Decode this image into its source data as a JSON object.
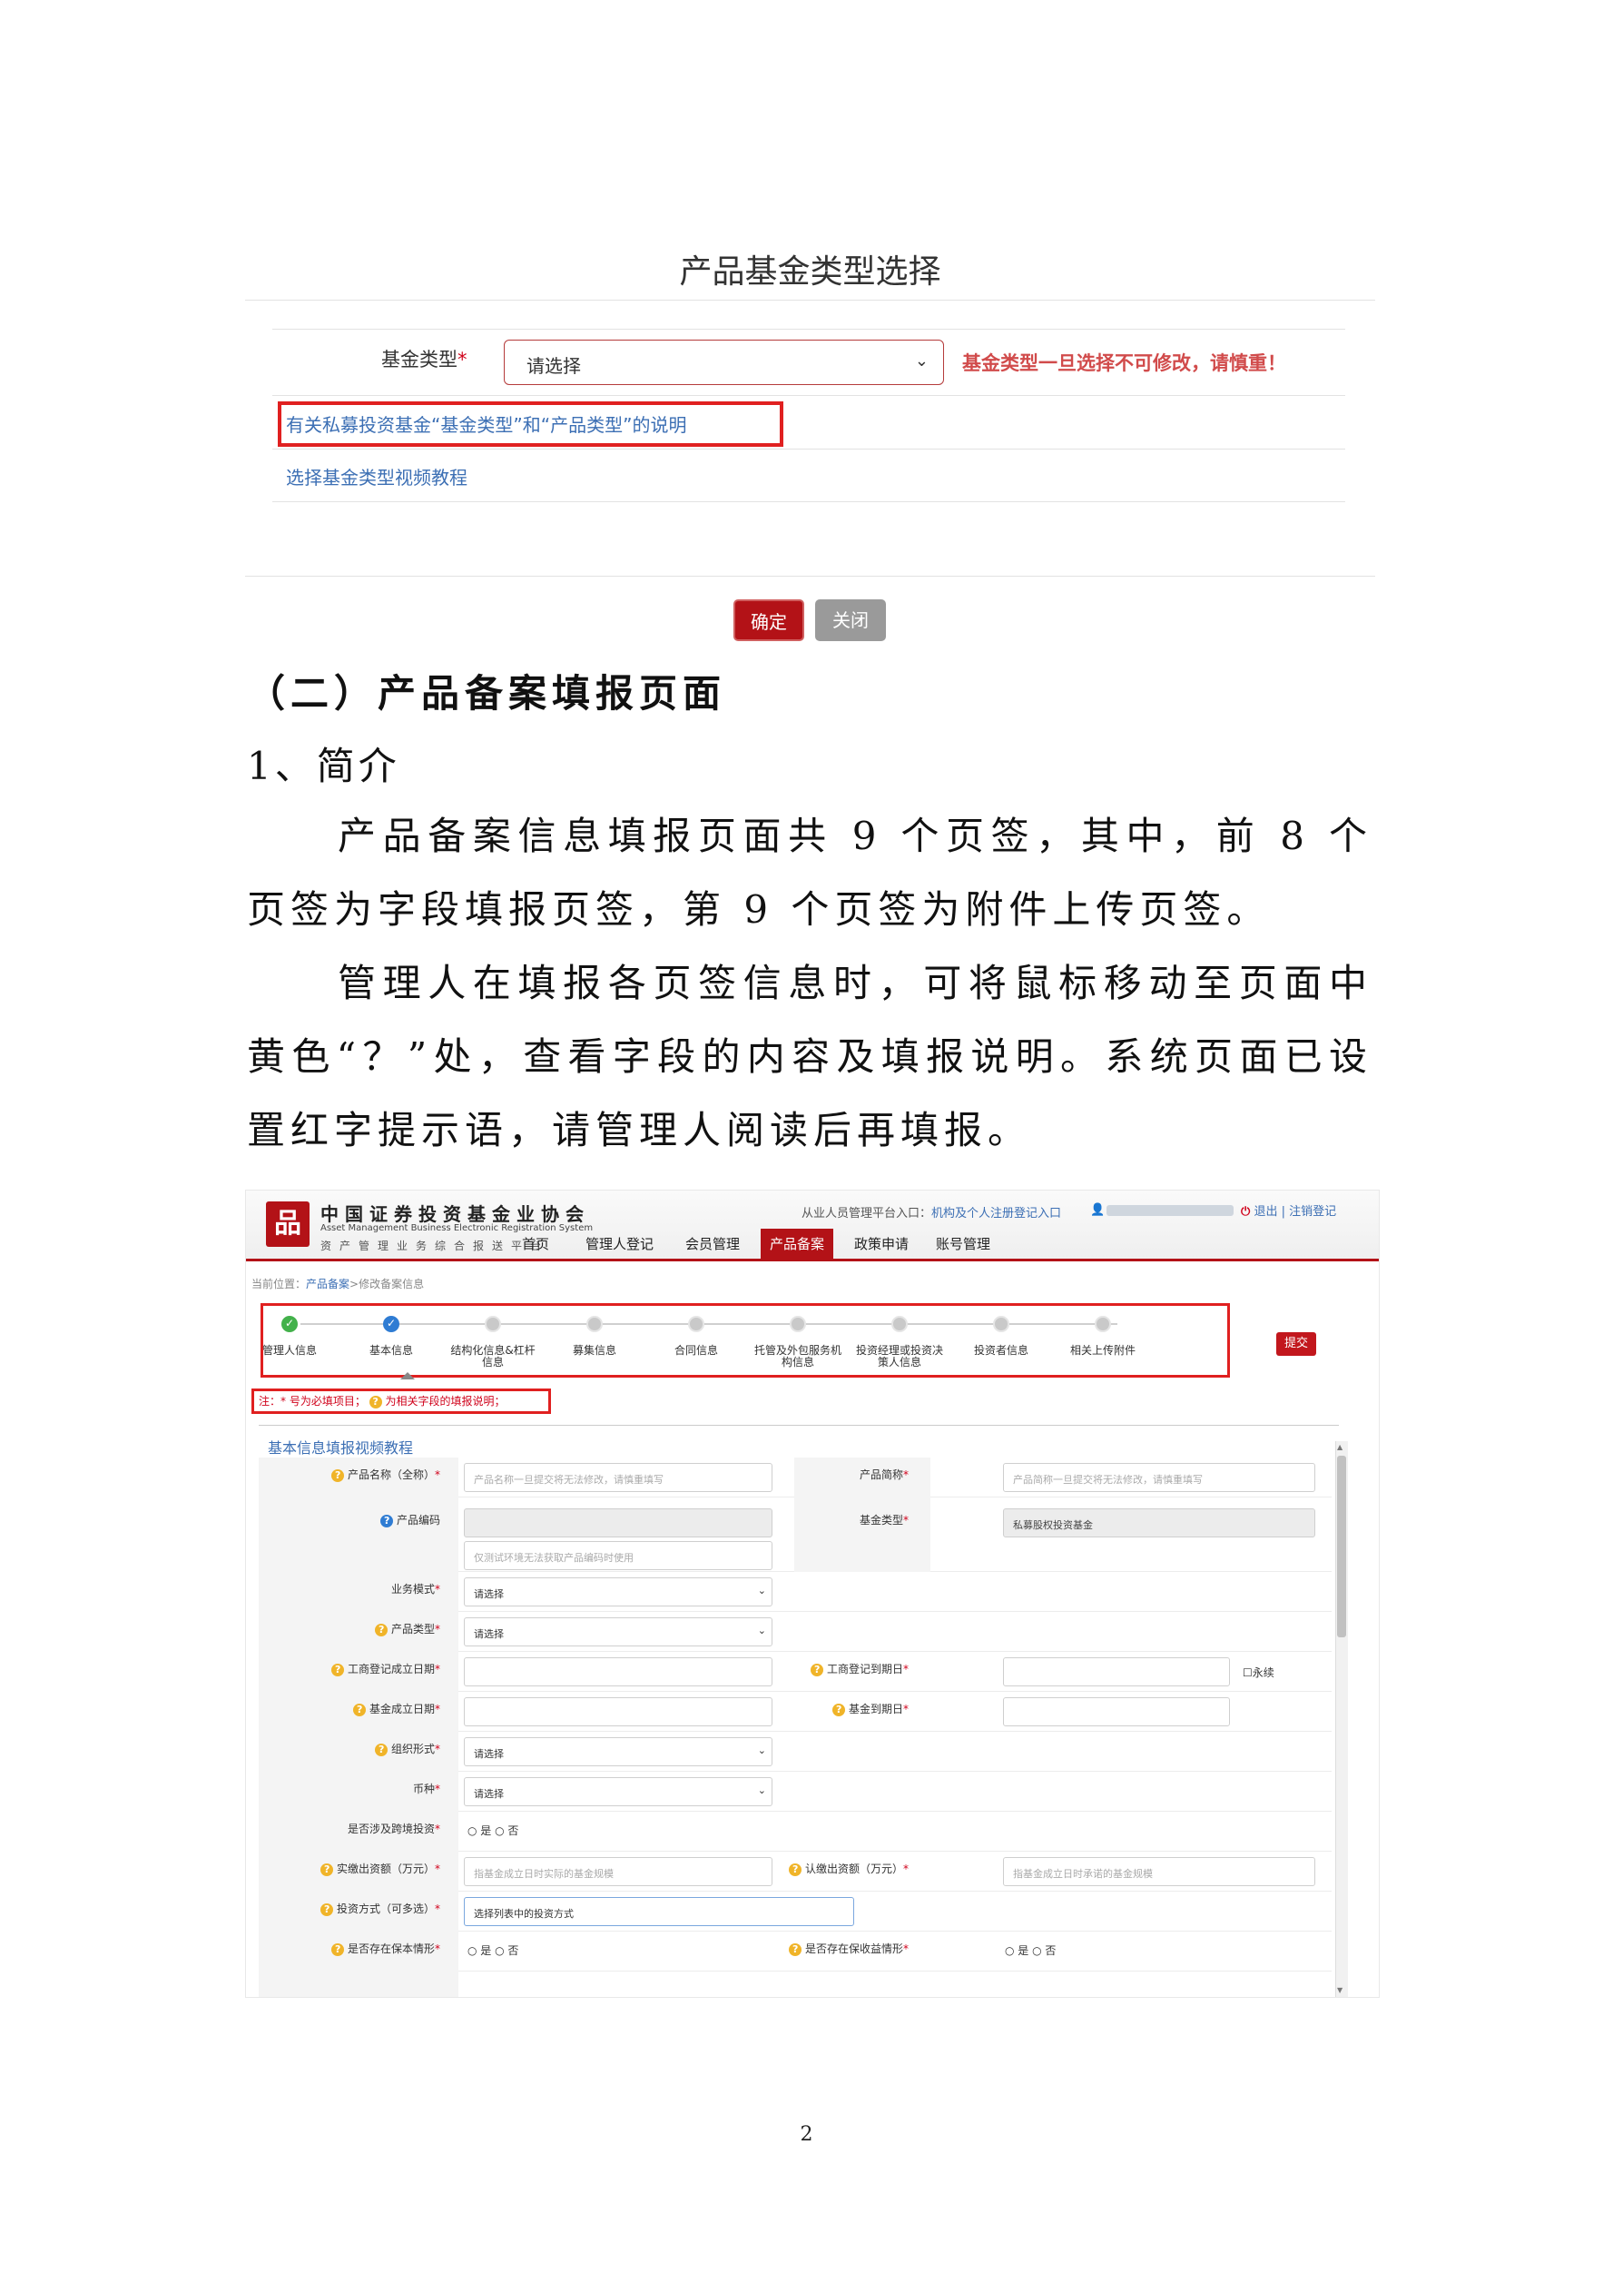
{
  "dialog": {
    "title": "产品基金类型选择",
    "field_label": "基金类型",
    "required_mark": "*",
    "select_value": "请选择",
    "warning": "基金类型一旦选择不可修改，请慎重！",
    "link_explanation": "有关私募投资基金“基金类型”和“产品类型”的说明",
    "link_video": "选择基金类型视频教程",
    "ok_label": "确定",
    "close_label": "关闭"
  },
  "doc": {
    "heading2": "（二）产品备案填报页面",
    "heading3": "1、简介",
    "para1": "产品备案信息填报页面共 9 个页签，其中，前 8 个页签为字段填报页签，第 9 个页签为附件上传页签。",
    "para2": "管理人在填报各页签信息时，可将鼠标移动至页面中黄色“？”处，查看字段的内容及填报说明。系统页面已设置红字提示语，请管理人阅读后再填报。",
    "page_number": "2"
  },
  "shot": {
    "site_name_cn": "中国证券投资基金业协会",
    "site_name_en": "Asset Management Business Electronic Registration System",
    "site_subtitle": "资产管理业务综合报送平台",
    "portal_text": "从业人员管理平台入口：",
    "portal_link": "机构及个人注册登记入口",
    "logout": "退出",
    "cancel_registration": "注销登记",
    "nav": [
      "首页",
      "管理人登记",
      "会员管理",
      "产品备案",
      "政策申请",
      "账号管理"
    ],
    "nav_active_index": 3,
    "breadcrumb_prefix": "当前位置：",
    "breadcrumb_link": "产品备案",
    "breadcrumb_current": ">修改备案信息",
    "steps": [
      "管理人信息",
      "基本信息",
      "结构化信息&杠杆信息",
      "募集信息",
      "合同信息",
      "托管及外包服务机构信息",
      "投资经理或投资决策人信息",
      "投资者信息",
      "相关上传附件"
    ],
    "steps_done": 1,
    "steps_current": 1,
    "submit": "提交",
    "note_part1": "注：* 号为必填项目；",
    "note_part2": "为相关字段的填报说明；",
    "form_title": "基本信息填报视频教程",
    "fields": {
      "product_name_label": "产品名称（全称）",
      "product_name_ph": "产品名称一旦提交将无法修改，请慎重填写",
      "product_short_label": "产品简称",
      "product_short_ph": "产品简称一旦提交将无法修改，请慎重填写",
      "product_code_label": "产品编码",
      "product_code_hint": "仅测试环境无法获取产品编码时使用",
      "fund_type_label": "基金类型",
      "fund_type_value": "私募股权投资基金",
      "biz_mode_label": "业务模式",
      "product_type_label": "产品类型",
      "select_ph": "请选择",
      "reg_date_label": "工商登记成立日期",
      "reg_expire_label": "工商登记到期日",
      "perpetual_label": "永续",
      "fund_date_label": "基金成立日期",
      "fund_expire_label": "基金到期日",
      "org_form_label": "组织形式",
      "currency_label": "币种",
      "cross_border_label": "是否涉及跨境投资",
      "yes": "是",
      "no": "否",
      "paid_capital_label": "实缴出资额（万元）",
      "paid_capital_ph": "指基金成立日时实际的基金规模",
      "subscribed_label": "认缴出资额（万元）",
      "subscribed_ph": "指基金成立日时承诺的基金规模",
      "invest_mode_label": "投资方式（可多选）",
      "invest_mode_ph": "选择列表中的投资方式",
      "principal_guarantee_label": "是否存在保本情形",
      "return_guarantee_label": "是否存在保收益情形"
    }
  }
}
